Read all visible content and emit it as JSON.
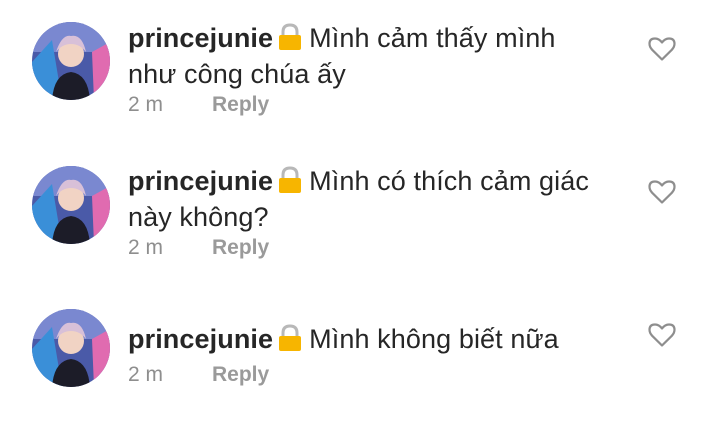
{
  "comments": [
    {
      "username": "princejunie",
      "lock_icon": "lock-icon",
      "text": "Mình cảm thấy mình như công chúa ấy",
      "time": "2 m",
      "reply_label": "Reply"
    },
    {
      "username": "princejunie",
      "lock_icon": "lock-icon",
      "text": "Mình có thích cảm giác này không?",
      "time": "2 m",
      "reply_label": "Reply"
    },
    {
      "username": "princejunie",
      "lock_icon": "lock-icon",
      "text": "Mình không biết nữa",
      "time": "2 m",
      "reply_label": "Reply"
    }
  ],
  "colors": {
    "text": "#262626",
    "meta": "#8e8e8e",
    "lock": "#f7b500"
  }
}
